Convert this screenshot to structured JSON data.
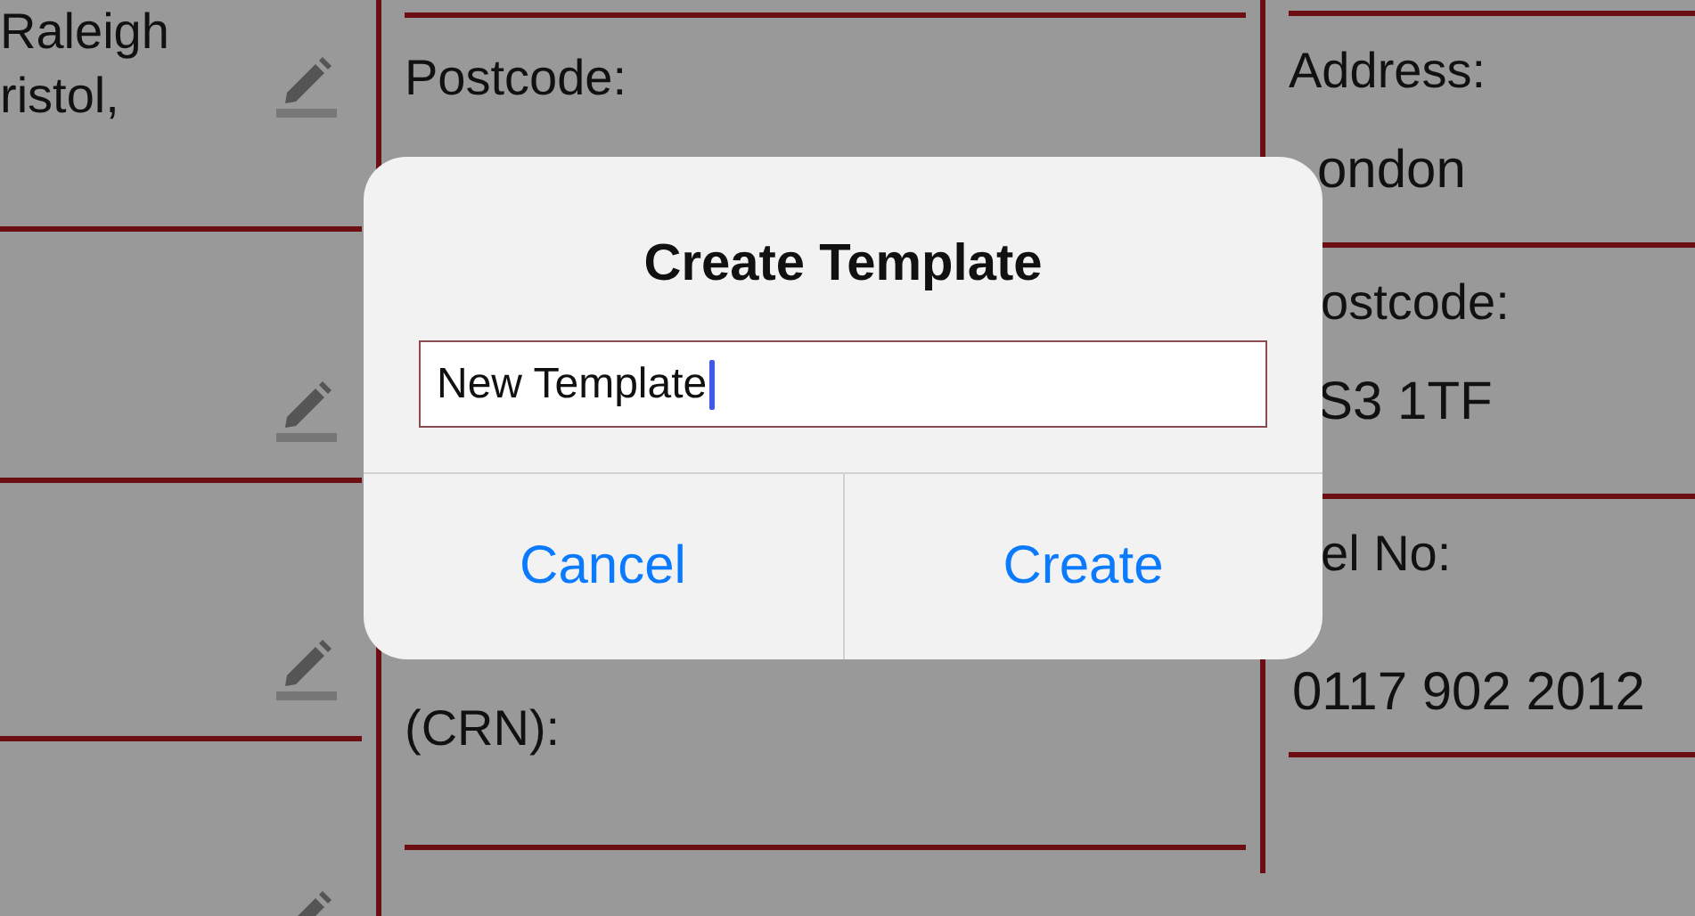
{
  "left_column": {
    "first_row_lines": [
      "Raleigh",
      "ristol,"
    ]
  },
  "middle_column": {
    "labels": [
      "Postcode:",
      "(CRN):"
    ]
  },
  "right_column": {
    "fields": [
      {
        "label": "Address:",
        "value": "ondon"
      },
      {
        "label": "ostcode:",
        "value": "S3 1TF"
      },
      {
        "label": "el No:",
        "value": "0117 902 2012"
      }
    ]
  },
  "dialog": {
    "title": "Create Template",
    "input": {
      "value": "New Template",
      "focused": true
    },
    "buttons": [
      "Cancel",
      "Create"
    ]
  }
}
